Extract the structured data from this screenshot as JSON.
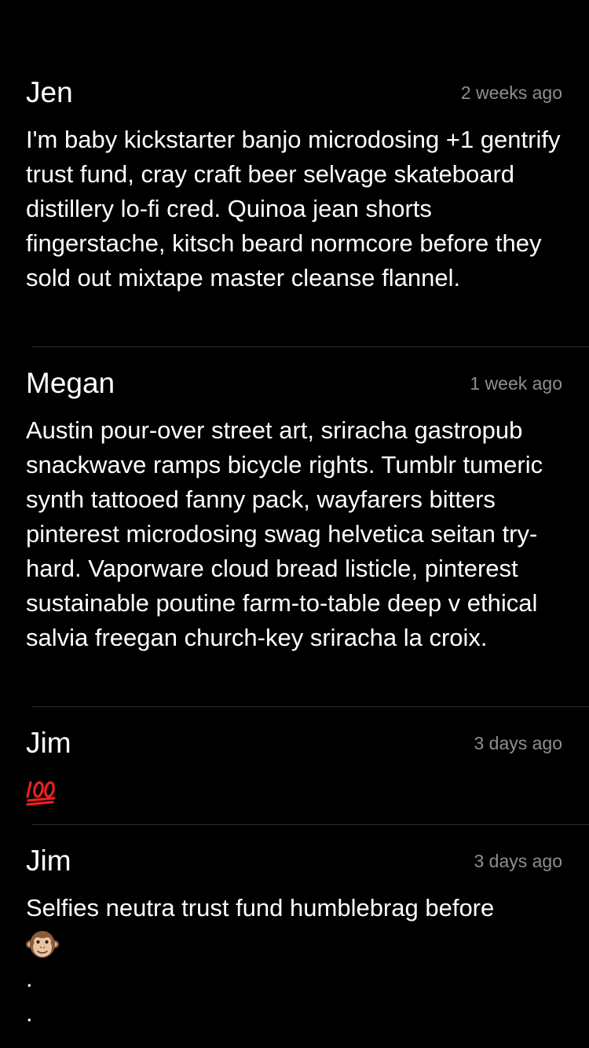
{
  "comments": [
    {
      "author": "Jen",
      "time": "2 weeks ago",
      "text": "I'm baby kickstarter banjo microdosing +1 gentrify trust fund, cray craft beer selvage skateboard distillery lo-fi cred. Quinoa jean shorts fingerstache, kitsch beard normcore before they sold out mixtape master cleanse flannel."
    },
    {
      "author": "Megan",
      "time": "1 week ago",
      "text": "Austin pour-over street art, sriracha gastropub snackwave ramps bicycle rights. Tumblr tumeric synth tattooed fanny pack, wayfarers bitters pinterest microdosing swag helvetica seitan try-hard. Vaporware cloud bread listicle, pinterest sustainable poutine farm-to-table deep v ethical salvia freegan church-key sriracha la croix."
    },
    {
      "author": "Jim",
      "time": "3 days ago",
      "emoji": "hundred-points-icon"
    },
    {
      "author": "Jim",
      "time": "3 days ago",
      "text": "Selfies neutra trust fund humblebrag before",
      "emoji": "monkey-face-icon",
      "dots": [
        ".",
        "."
      ]
    }
  ],
  "colors": {
    "background": "#000000",
    "text": "#ffffff",
    "secondary": "#8e8e93",
    "divider": "#2e2e30",
    "hundred_red": "#e8211f"
  }
}
